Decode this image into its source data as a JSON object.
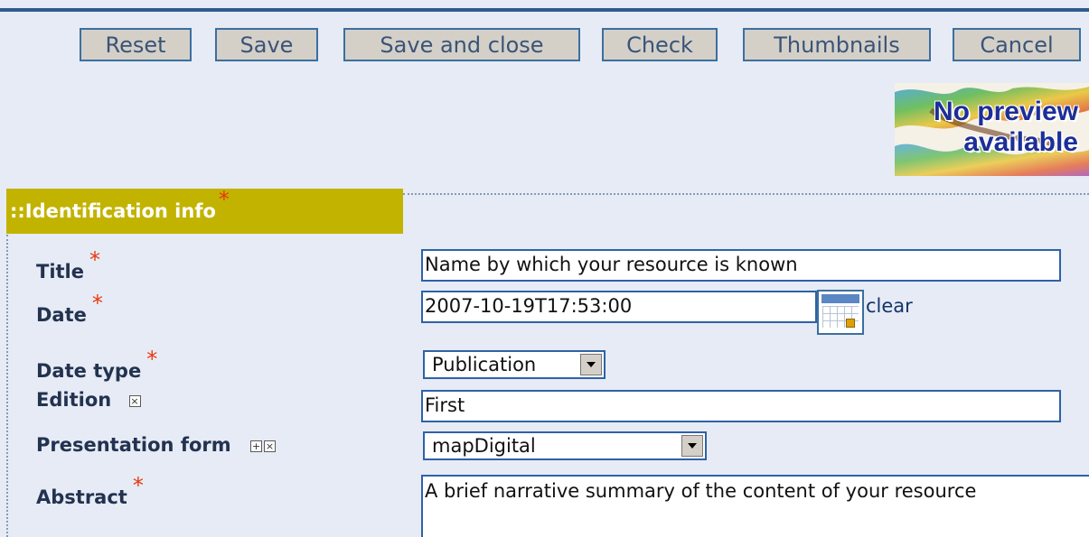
{
  "toolbar": {
    "buttons": [
      "Reset",
      "Save",
      "Save and close",
      "Check",
      "Thumbnails",
      "Cancel"
    ]
  },
  "preview": {
    "line1": "No preview",
    "line2": "available"
  },
  "section": {
    "title": "::Identification info",
    "required_mark": "*"
  },
  "fields": {
    "title": {
      "label": "Title",
      "value": "Name by which your resource is known"
    },
    "date": {
      "label": "Date",
      "value": "2007-10-19T17:53:00",
      "clear": "clear"
    },
    "date_type": {
      "label": "Date type",
      "value": "Publication"
    },
    "edition": {
      "label": "Edition",
      "value": "First"
    },
    "presentation_form": {
      "label": "Presentation form",
      "value": "mapDigital"
    },
    "abstract": {
      "label": "Abstract",
      "value": "A brief narrative summary of the content of your resource"
    }
  },
  "colors": {
    "page_bg": "#e6ebf5",
    "section_header_bg": "#c2b300",
    "required": "#e8380e",
    "field_border": "#2e62a6"
  },
  "icons": [
    "calendar-icon",
    "add-icon",
    "remove-icon",
    "dropdown-arrow-icon"
  ]
}
